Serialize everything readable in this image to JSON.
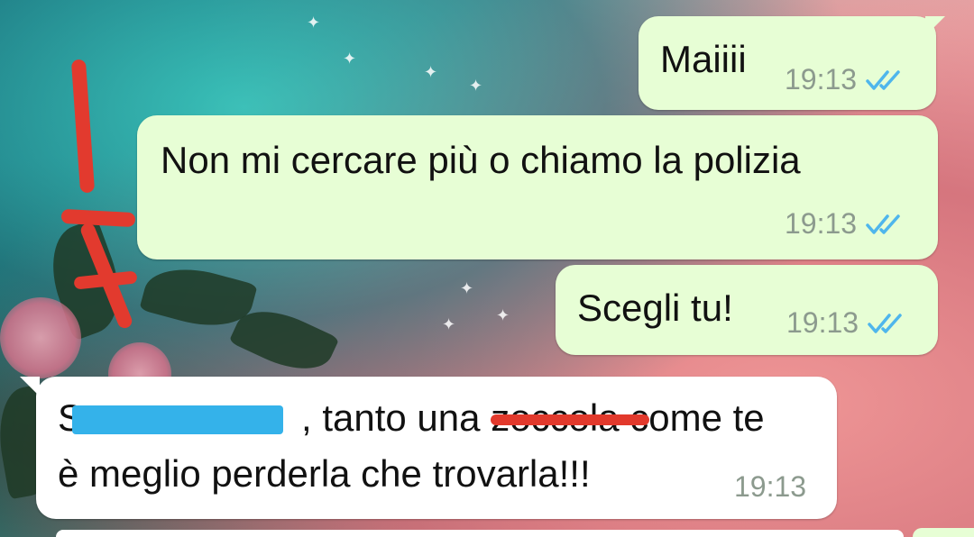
{
  "messages": [
    {
      "text": "Maiiii",
      "time": "19:13",
      "status": "read-double-check-icon"
    },
    {
      "text": "Non mi cercare più o chiamo la polizia",
      "time": "19:13",
      "status": "read-double-check-icon"
    },
    {
      "text": "Scegli tu!",
      "time": "19:13",
      "status": "read-double-check-icon"
    },
    {
      "line1_start": "S",
      "line1_mid": ", tanto una ",
      "line1_struck": "zoccola",
      "line1_end": " come te",
      "line2": "è meglio perderla che trovarla!!!",
      "time": "19:13"
    }
  ],
  "annotation": {
    "label": "1-7",
    "color": "#e23a2e"
  },
  "colors": {
    "outgoing": "#e7fed5",
    "incoming": "#ffffff",
    "read_ticks": "#4fb6ec",
    "timestamp": "#8c9a8e",
    "redaction": "#34b2ea"
  }
}
